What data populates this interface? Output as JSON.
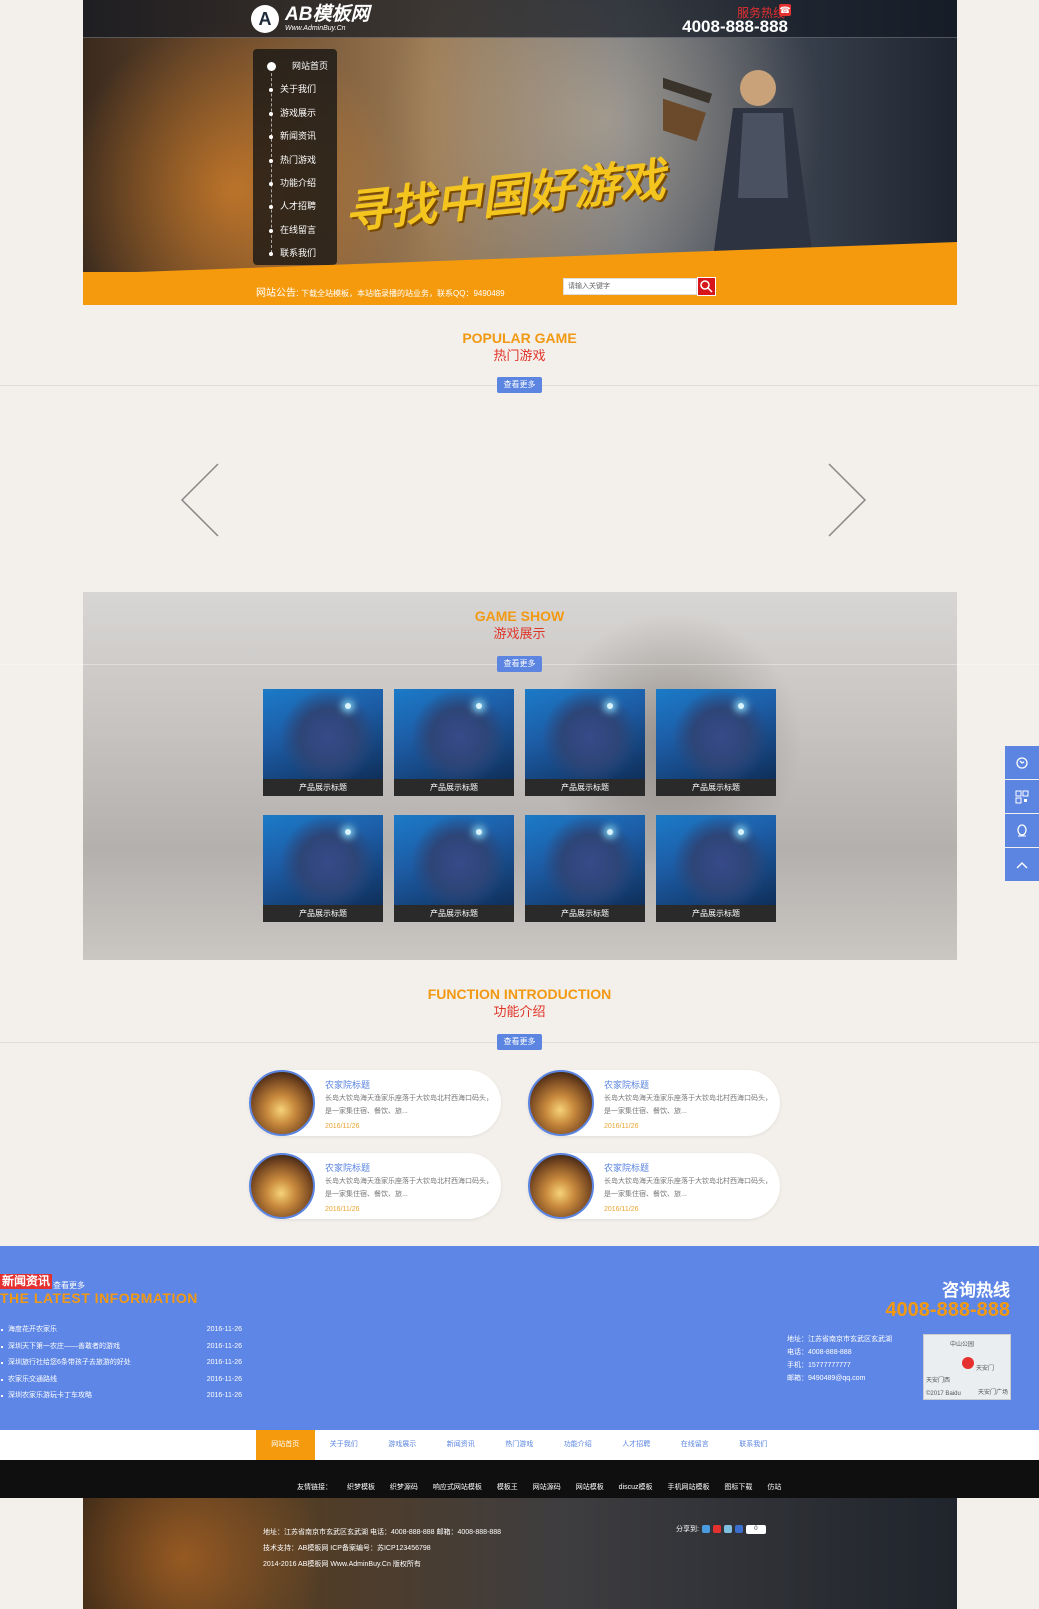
{
  "header": {
    "logo_mark": "A",
    "logo_text": "AB模板网",
    "logo_sub": "Www.AdminBuy.Cn",
    "hotline_label": "服务热线",
    "hotline_number": "4008-888-888",
    "slogan": "寻找中国好游戏",
    "nav": [
      "网站首页",
      "关于我们",
      "游戏展示",
      "新闻资讯",
      "热门游戏",
      "功能介绍",
      "人才招聘",
      "在线留言",
      "联系我们"
    ],
    "notice_label": "网站公告:",
    "notice_text": "下载全站模板，本站临录播的站业务，联系QQ：9490489",
    "search_placeholder": "请输入关键字"
  },
  "popular": {
    "en": "POPULAR GAME",
    "cn": "热门游戏",
    "more": "查看更多"
  },
  "game_show": {
    "en": "GAME SHOW",
    "cn": "游戏展示",
    "more": "查看更多",
    "items": [
      "产品展示标题",
      "产品展示标题",
      "产品展示标题",
      "产品展示标题",
      "产品展示标题",
      "产品展示标题",
      "产品展示标题",
      "产品展示标题"
    ]
  },
  "function": {
    "en": "FUNCTION INTRODUCTION",
    "cn": "功能介绍",
    "more": "查看更多",
    "items": [
      {
        "title": "农家院标题",
        "desc": "长岛大钦岛海天渔家乐座落于大钦岛北村西海口码头，是一家集住宿、餐饮、旅...",
        "date": "2016/11/26"
      },
      {
        "title": "农家院标题",
        "desc": "长岛大钦岛海天渔家乐座落于大钦岛北村西海口码头，是一家集住宿、餐饮、旅...",
        "date": "2016/11/26"
      },
      {
        "title": "农家院标题",
        "desc": "长岛大钦岛海天渔家乐座落于大钦岛北村西海口码头，是一家集住宿、餐饮、旅...",
        "date": "2016/11/26"
      },
      {
        "title": "农家院标题",
        "desc": "长岛大钦岛海天渔家乐座落于大钦岛北村西海口码头，是一家集住宿、餐饮、旅...",
        "date": "2016/11/26"
      }
    ]
  },
  "news": {
    "tag": "新闻资讯",
    "more": "查看更多",
    "en": "THE LATEST INFORMATION",
    "items": [
      {
        "title": "海度花开农家乐",
        "date": "2016-11-26"
      },
      {
        "title": "深圳天下第一农庄——善敢者的游戏",
        "date": "2016-11-26"
      },
      {
        "title": "深圳旅行社给您6条带孩子去旅游的好处",
        "date": "2016-11-26"
      },
      {
        "title": "农家乐交通路线",
        "date": "2016-11-26"
      },
      {
        "title": "深圳农家乐游玩卡丁车攻略",
        "date": "2016-11-26"
      }
    ]
  },
  "consult": {
    "title": "咨询热线",
    "number": "4008-888-888",
    "address": "地址：江苏省南京市玄武区玄武湖",
    "phone": "电话：4008-888-888",
    "mobile": "手机：15777777777",
    "email": "邮箱：9490489@qq.com",
    "map_label_1": "中山公园",
    "map_label_2": "天安门西",
    "map_label_3": "天安门",
    "map_label_4": "天安门广场",
    "map_copyright": "©2017 Baidu"
  },
  "footer_nav": [
    "网站首页",
    "关于我们",
    "游戏展示",
    "新闻资讯",
    "热门游戏",
    "功能介绍",
    "人才招聘",
    "在线留言",
    "联系我们"
  ],
  "links": {
    "label": "友情链接：",
    "items": [
      "织梦模板",
      "织梦源码",
      "响应式网站模板",
      "模板王",
      "网站源码",
      "网站模板",
      "discuz模板",
      "手机网站模板",
      "图标下载",
      "仿站"
    ]
  },
  "bottom": {
    "line1": "地址：江苏省南京市玄武区玄武湖   电话：4008-888-888   邮箱：4008-888-888",
    "line2": "技术支持：AB模板网    ICP备案编号：苏ICP123456798",
    "line3": "2014-2016 AB模板网 Www.AdminBuy.Cn 版权所有",
    "share_label": "分享到:",
    "share_count": "0"
  }
}
